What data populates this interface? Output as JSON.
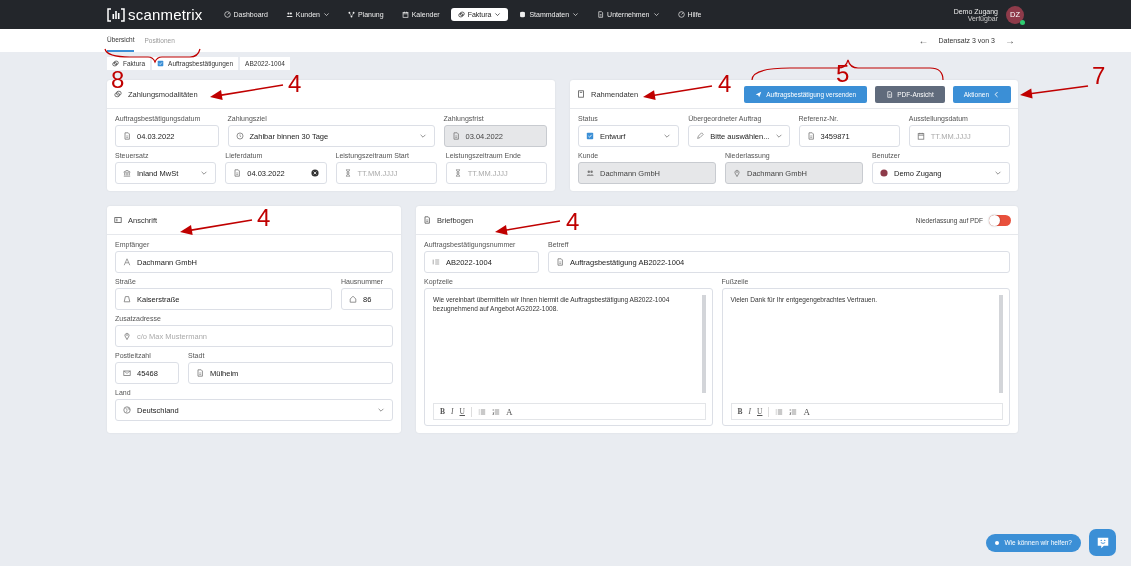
{
  "nav": {
    "logo": "scanmetrix",
    "items": [
      {
        "label": "Dashboard",
        "dropdown": false,
        "selected": false
      },
      {
        "label": "Kunden",
        "dropdown": true,
        "selected": false
      },
      {
        "label": "Planung",
        "dropdown": false,
        "selected": false
      },
      {
        "label": "Kalender",
        "dropdown": false,
        "selected": false
      },
      {
        "label": "Faktura",
        "dropdown": true,
        "selected": true
      },
      {
        "label": "Stammdaten",
        "dropdown": true,
        "selected": false
      },
      {
        "label": "Unternehmen",
        "dropdown": true,
        "selected": false
      },
      {
        "label": "Hilfe",
        "dropdown": false,
        "selected": false
      }
    ],
    "user": {
      "name": "Demo Zugang",
      "status": "Verfügbar",
      "initials": "DZ"
    }
  },
  "subtabs": [
    {
      "label": "Übersicht",
      "selected": true
    },
    {
      "label": "Positionen",
      "selected": false
    }
  ],
  "pager": {
    "prev": "←",
    "label": "Datensatz 3 von 3",
    "next": "→"
  },
  "breadcrumb": [
    "Faktura",
    "Auftragsbestätigungen",
    "AB2022-1004"
  ],
  "cards": [
    {
      "title": "Zahlungsmodalitäten",
      "fields": [
        {
          "label": "Auftragsbestätigungsdatum",
          "value": "04.03.2022",
          "kind": "text",
          "disabled": false
        },
        {
          "label": "Zahlungsziel",
          "value": "Zahlbar binnen 30 Tage",
          "kind": "select",
          "disabled": false
        },
        {
          "label": "Zahlungsfrist",
          "value": "03.04.2022",
          "kind": "text",
          "disabled": true
        },
        {
          "label": "Steuersatz",
          "value": "Inland MwSt",
          "kind": "select",
          "disabled": false
        },
        {
          "label": "Lieferdatum",
          "value": "04.03.2022",
          "kind": "clearable",
          "disabled": false
        },
        {
          "label": "Leistungszeitraum Start",
          "placeholder": "TT.MM.JJJJ",
          "kind": "text",
          "disabled": false
        },
        {
          "label": "Leistungszeitraum Ende",
          "placeholder": "TT.MM.JJJJ",
          "kind": "text",
          "disabled": false
        }
      ]
    },
    {
      "title": "Rahmendaten",
      "buttons": [
        {
          "label": "Auftragsbestätigung versenden",
          "kind": "primary"
        },
        {
          "label": "PDF-Ansicht",
          "kind": "secondary"
        },
        {
          "label": "Aktionen",
          "kind": "primary"
        }
      ],
      "fields": [
        {
          "label": "Status",
          "value": "Entwurf",
          "kind": "select",
          "disabled": false
        },
        {
          "label": "Übergeordneter Auftrag",
          "value": "Bitte auswählen...",
          "kind": "select",
          "disabled": false
        },
        {
          "label": "Referenz-Nr.",
          "value": "3459871",
          "kind": "text",
          "disabled": false
        },
        {
          "label": "Ausstellungsdatum",
          "placeholder": "TT.MM.JJJJ",
          "kind": "text",
          "disabled": false
        },
        {
          "label": "Kunde",
          "value": "Dachmann GmbH",
          "kind": "text",
          "disabled": true
        },
        {
          "label": "Niederlassung",
          "value": "Dachmann GmbH",
          "kind": "text",
          "disabled": true
        },
        {
          "label": "Benutzer",
          "value": "Demo Zugang",
          "kind": "select",
          "disabled": false
        }
      ]
    },
    {
      "title": "Anschrift",
      "fields": [
        {
          "label": "Empfänger",
          "value": "Dachmann GmbH",
          "kind": "text",
          "disabled": false
        },
        {
          "label": "Straße",
          "value": "Kaiserstraße",
          "kind": "text",
          "disabled": false
        },
        {
          "label": "Hausnummer",
          "value": "86",
          "kind": "text",
          "disabled": false
        },
        {
          "label": "Zusatzadresse",
          "placeholder": "c/o Max Mustermann",
          "kind": "text",
          "disabled": false
        },
        {
          "label": "Postleitzahl",
          "value": "45468",
          "kind": "text",
          "disabled": false
        },
        {
          "label": "Stadt",
          "value": "Mülheim",
          "kind": "text",
          "disabled": false
        },
        {
          "label": "Land",
          "value": "Deutschland",
          "kind": "select",
          "disabled": false
        }
      ]
    },
    {
      "title": "Briefbogen",
      "toggle": {
        "label": "Niederlassung auf PDF",
        "on": false
      },
      "fields": [
        {
          "label": "Auftragsbestätigungsnummer",
          "value": "AB2022-1004",
          "kind": "text",
          "disabled": false
        },
        {
          "label": "Betreff",
          "value": "Auftragsbestätigung AB2022-1004",
          "kind": "text",
          "disabled": false
        },
        {
          "label": "Kopfzeile",
          "value": "Wie vereinbart übermitteln wir Ihnen hiermit die Auftragsbestätigung AB2022-1004 bezugnehmend auf Angebot AG2022-1008.",
          "kind": "editor",
          "toolbar": [
            "B",
            "I",
            "U",
            "A"
          ]
        },
        {
          "label": "Fußzeile",
          "value": "Vielen Dank für Ihr entgegengebrachtes Vertrauen.",
          "kind": "editor",
          "toolbar": [
            "B",
            "I",
            "U",
            "A"
          ]
        }
      ]
    }
  ],
  "help": {
    "label": "Wie können wir helfen?"
  },
  "annotations": [
    {
      "label": "8"
    },
    {
      "label": "4"
    },
    {
      "label": "4"
    },
    {
      "label": "5"
    },
    {
      "label": "7"
    },
    {
      "label": "4"
    },
    {
      "label": "4"
    }
  ]
}
